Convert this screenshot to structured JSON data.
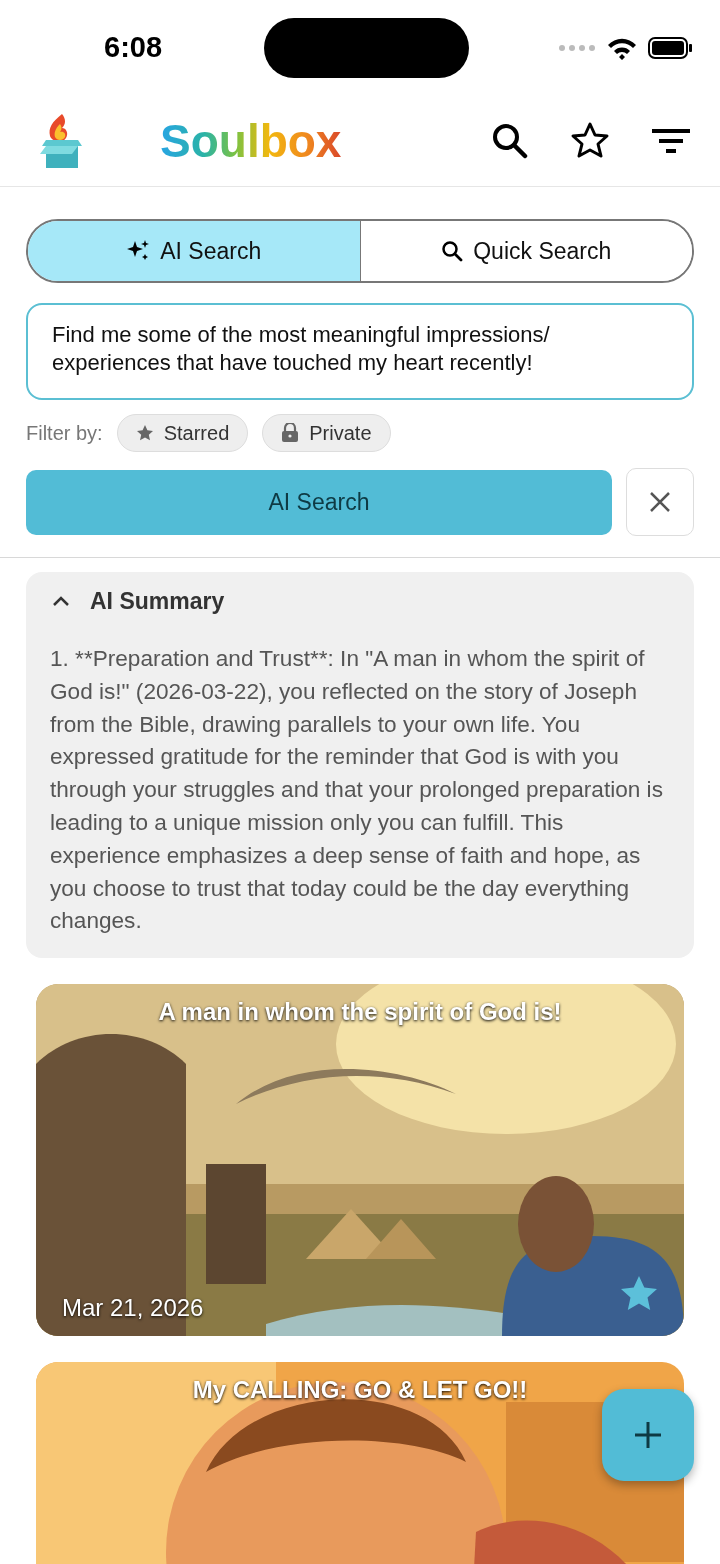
{
  "status_bar": {
    "time": "6:08"
  },
  "header": {
    "title": "Soulbox"
  },
  "search_modes": [
    {
      "label": "AI Search",
      "kind": "ai",
      "selected": true
    },
    {
      "label": "Quick Search",
      "kind": "quick",
      "selected": false
    }
  ],
  "query": {
    "value": "Find me some of the most meaningful impressions/ experiences that have touched my heart recently!"
  },
  "filter": {
    "label": "Filter by:",
    "chips": [
      {
        "label": "Starred",
        "kind": "star",
        "selected": false
      },
      {
        "label": "Private",
        "kind": "lock",
        "selected": false
      }
    ]
  },
  "search_button": {
    "label": "AI Search"
  },
  "summary": {
    "title": "AI Summary",
    "expanded": true,
    "text": "1. **Preparation and Trust**: In \"A man in whom the spirit of God is!\" (2026-03-22), you reflected on the story of Joseph from the Bible, drawing parallels to your own life. You expressed gratitude for the reminder that God is with you through your struggles and that your prolonged preparation is leading to a unique mission only you can fulfill. This experience emphasizes a deep sense of faith and hope, as you choose to trust that today could be the day everything changes."
  },
  "entries": [
    {
      "title": "A man in whom the spirit of God is!",
      "date": "Mar 21, 2026",
      "starred": true
    },
    {
      "title": "My CALLING: GO & LET GO!!"
    }
  ]
}
